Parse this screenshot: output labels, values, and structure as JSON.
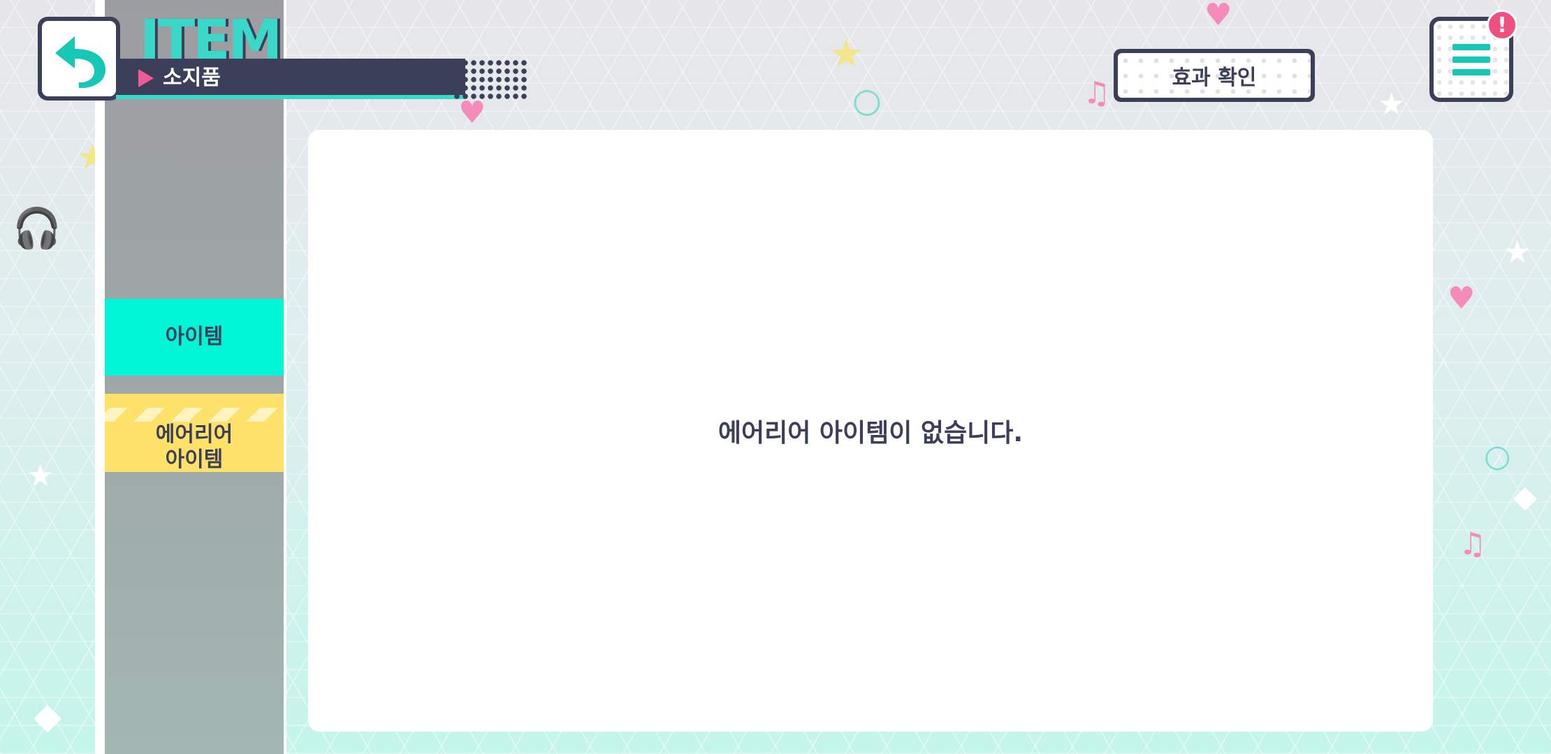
{
  "header": {
    "title": "ITEM",
    "subtitle": "소지품",
    "effect_button": "효과 확인",
    "notification_badge": "!"
  },
  "sidebar": {
    "items": [
      {
        "label": "아이템",
        "active": true
      },
      {
        "label": "에어리어\n아이템",
        "active": false
      }
    ]
  },
  "main": {
    "empty_message": "에어리어 아이템이 없습니다."
  },
  "icons": {
    "back": "back-arrow-icon",
    "menu": "hamburger-menu-icon"
  },
  "colors": {
    "accent_teal": "#00f4d6",
    "dark_navy": "#3b3f5a",
    "tab_yellow": "#fde168",
    "badge_pink": "#f0507f"
  }
}
